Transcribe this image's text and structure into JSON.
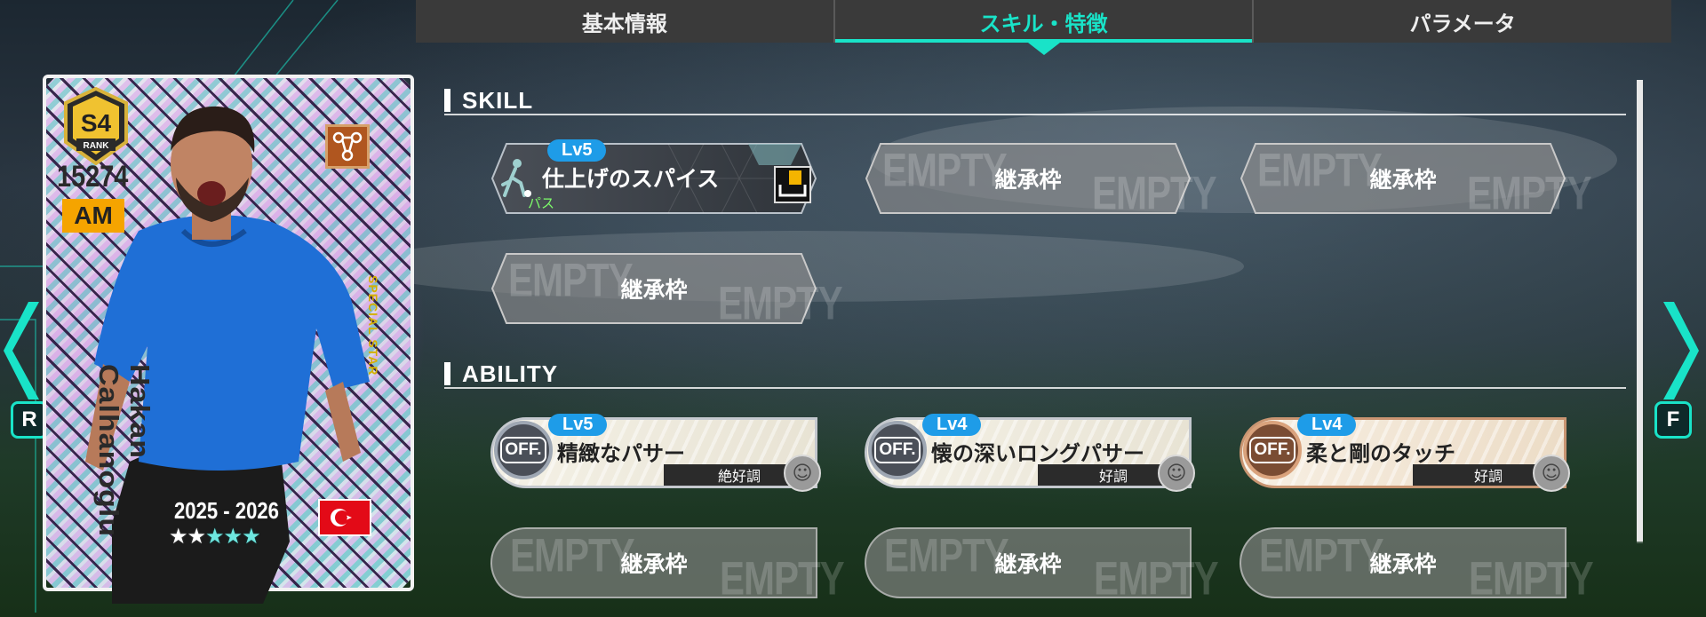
{
  "tabs": [
    {
      "label": "基本情報",
      "active": false
    },
    {
      "label": "スキル・特徴",
      "active": true
    },
    {
      "label": "パラメータ",
      "active": false
    }
  ],
  "accent_color": "#19e3c8",
  "sections": {
    "skill": {
      "title": "SKILL"
    },
    "ability": {
      "title": "ABILITY"
    }
  },
  "empty_watermark": "EMPTY",
  "skills": {
    "equipped": {
      "level": "Lv5",
      "name": "仕上げのスパイス",
      "category": "パス"
    },
    "slot_label": "継承枠"
  },
  "abilities": [
    {
      "level": "Lv5",
      "badge": "OFF.",
      "name": "精緻なパサー",
      "condition": "絶好調",
      "tier": "silver"
    },
    {
      "level": "Lv4",
      "badge": "OFF.",
      "name": "懐の深いロングパサー",
      "condition": "好調",
      "tier": "silver"
    },
    {
      "level": "Lv4",
      "badge": "OFF.",
      "name": "柔と剛のタッチ",
      "condition": "好調",
      "tier": "bronze"
    }
  ],
  "ability_slot_label": "継承枠",
  "nav": {
    "left_key": "R",
    "right_key": "F"
  },
  "card": {
    "rank": "S4",
    "rank_label": "RANK",
    "overall": "15274",
    "position": "AM",
    "player_name": "Hakan Calhanoglu",
    "edition": "SPECIAL STAR",
    "season": "2025 - 2026",
    "stars_total": 5,
    "stars_highlighted": 3,
    "nationality_flag": "turkey"
  }
}
